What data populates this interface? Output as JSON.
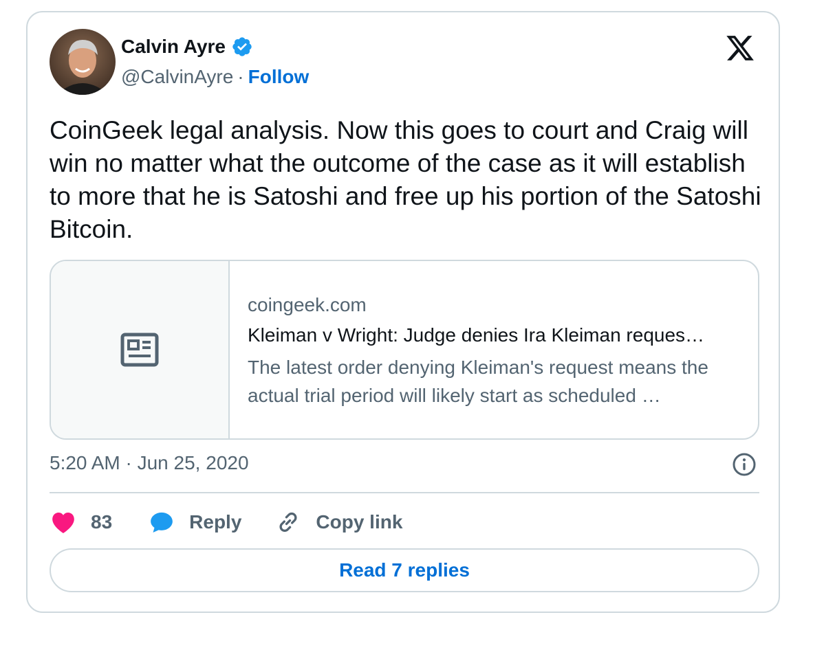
{
  "author": {
    "name": "Calvin Ayre",
    "handle": "@CalvinAyre",
    "separator": "·",
    "follow_label": "Follow",
    "verified": true
  },
  "icons": {
    "verified": "verified-badge-icon",
    "platform": "x-logo-icon",
    "link_thumb": "newspaper-icon",
    "info": "info-icon",
    "like": "heart-icon",
    "reply": "speech-bubble-icon",
    "copy": "link-icon"
  },
  "tweet": {
    "text": "CoinGeek legal analysis.  Now this goes to court and Craig will win no matter what the outcome of the case as it will establish to more that he is Satoshi and free up his portion of the Satoshi Bitcoin."
  },
  "link_card": {
    "domain": "coingeek.com",
    "title": "Kleiman v Wright: Judge denies Ira Kleiman reques…",
    "description": "The latest order denying Kleiman's request means the actual trial period will likely start as scheduled …"
  },
  "meta": {
    "timestamp": "5:20 AM · Jun 25, 2020"
  },
  "actions": {
    "like_count": "83",
    "reply_label": "Reply",
    "copy_label": "Copy link"
  },
  "read_replies_label": "Read 7 replies",
  "colors": {
    "accent": "#006fd6",
    "like": "#f91880",
    "reply": "#1d9bf0",
    "muted": "#536471",
    "border": "#cfd9de"
  }
}
